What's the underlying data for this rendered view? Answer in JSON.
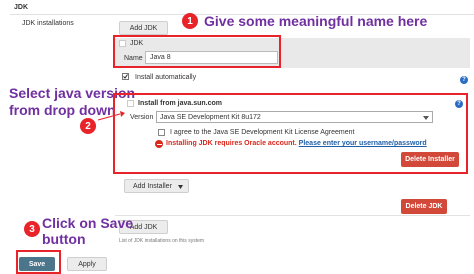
{
  "section": {
    "header": "JDK",
    "installations_label": "JDK installations",
    "footer_note": "List of JDK installations on this system"
  },
  "buttons": {
    "add_jdk_top": "Add JDK",
    "add_installer": "Add Installer",
    "delete_installer": "Delete Installer",
    "delete_jdk": "Delete JDK",
    "add_jdk_bottom": "Add JDK",
    "save": "Save",
    "apply": "Apply"
  },
  "jdk_form": {
    "box_title": "JDK",
    "name_label": "Name",
    "name_value": "Java 8",
    "install_auto_label": "Install automatically",
    "install_auto_checked": true
  },
  "installer": {
    "title": "Install from java.sun.com",
    "version_label": "Version",
    "version_value": "Java SE Development Kit 8u172",
    "agree_label": "I agree to the Java SE Development Kit License Agreement",
    "error_text": "Installing JDK requires Oracle account.",
    "error_link": "Please enter your username/password"
  },
  "callouts": {
    "c1_number": "1",
    "c1_text": "Give some meaningful name here",
    "c2_number": "2",
    "c2_line1": "Select java version",
    "c2_line2": "from drop down",
    "c3_number": "3",
    "c3_line1": "Click on Save",
    "c3_line2": "button"
  },
  "icons": {
    "help": "help-icon",
    "error": "error-icon",
    "dropdown": "caret-down-icon",
    "arrow": "arrow-icon"
  },
  "colors": {
    "annotation_red": "#e8232a",
    "callout_purple": "#7030a0",
    "danger_button": "#d24939",
    "save_button": "#4b758b",
    "help_blue": "#2b6cc4",
    "link_blue": "#1f5fa8"
  }
}
